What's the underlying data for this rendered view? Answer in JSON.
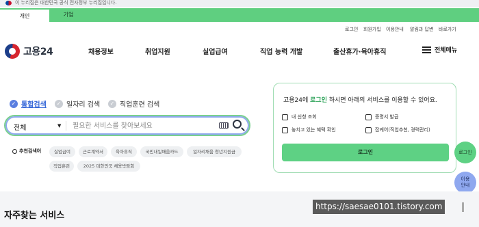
{
  "gov_banner": {
    "text": "이 누리집은 대한민국 공식 전자정부 누리집입니다."
  },
  "tabs": [
    {
      "label": "개인"
    },
    {
      "label": "기업"
    }
  ],
  "util_links": [
    {
      "label": "로그인"
    },
    {
      "label": "회원가입"
    },
    {
      "label": "이용안내"
    },
    {
      "label": "알림과 답변"
    },
    {
      "label": "바로가기"
    }
  ],
  "logo": {
    "text": "고용24"
  },
  "gnb": [
    {
      "label": "채용정보"
    },
    {
      "label": "취업지원"
    },
    {
      "label": "실업급여"
    },
    {
      "label": "직업 능력 개발"
    },
    {
      "label": "출산휴가·육아휴직"
    }
  ],
  "menu_all": {
    "label": "전체메뉴"
  },
  "search_scope": [
    {
      "label": "통합검색",
      "selected": true
    },
    {
      "label": "일자리 검색",
      "selected": false
    },
    {
      "label": "직업훈련 검색",
      "selected": false
    }
  ],
  "search": {
    "select_value": "전체",
    "placeholder": "필요한 서비스를 찾아보세요"
  },
  "recommended": {
    "label": "추천검색어",
    "chips": [
      {
        "label": "실업급여"
      },
      {
        "label": "근로계약서"
      },
      {
        "label": "육아휴직"
      },
      {
        "label": "국민내일배움카드"
      },
      {
        "label": "일자리채움 청년지원금"
      },
      {
        "label": "직업훈련"
      },
      {
        "label": "2025 대한민국 채용박람회"
      }
    ]
  },
  "login_panel": {
    "title_pre": "고용24에 ",
    "title_hl": "로그인",
    "title_post": " 하시면 아래의 서비스를 이용할 수 있어요.",
    "services": [
      {
        "label": "내 신청 조회",
        "icon": "doc-search-icon"
      },
      {
        "label": "증명서 발급",
        "icon": "certificate-icon"
      },
      {
        "label": "놓치고 있는 혜택 확인",
        "icon": "benefit-icon"
      },
      {
        "label": "잡케어(직업추천, 경력관리)",
        "icon": "jobcare-icon"
      }
    ],
    "button": "로그인"
  },
  "floating": {
    "login": "로그인",
    "guide_line1": "이용",
    "guide_line2": "안내"
  },
  "section": {
    "title": "자주찾는 서비스"
  },
  "watermark": "https://saesae0101.tistory.com",
  "colors": {
    "accent_green": "#5ed184",
    "accent_blue": "#3567d8",
    "guide_blue": "#8fa8ef"
  }
}
